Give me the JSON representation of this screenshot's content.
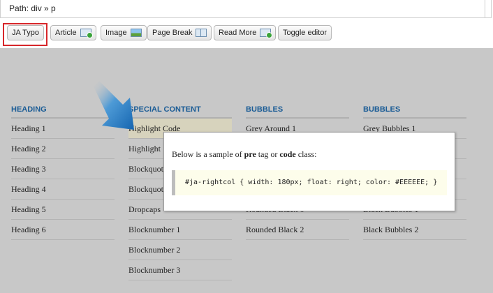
{
  "pathbar": {
    "text": "Path: div » p"
  },
  "toolbar": {
    "buttons": [
      {
        "label": "JA Typo"
      },
      {
        "label": "Article",
        "icon": "document-add-icon"
      },
      {
        "label": "Image",
        "icon": "image-icon"
      },
      {
        "label": "Page Break",
        "icon": "page-break-icon"
      },
      {
        "label": "Read More",
        "icon": "read-more-icon"
      },
      {
        "label": "Toggle editor"
      }
    ]
  },
  "columns": [
    {
      "heading": "HEADING",
      "items": [
        "Heading 1",
        "Heading 2",
        "Heading 3",
        "Heading 4",
        "Heading 5",
        "Heading 6"
      ]
    },
    {
      "heading": "SPECIAL CONTENT",
      "items": [
        "Highlight Code",
        "Highlight",
        "Blockquote",
        "Blockquote",
        "Dropcaps",
        "Blocknumber 1",
        "Blocknumber 2",
        "Blocknumber 3"
      ]
    },
    {
      "heading": "BUBBLES",
      "items": [
        "Grey Around 1",
        "",
        "",
        "",
        "Rounded Black 1",
        "Rounded Black 2"
      ]
    },
    {
      "heading": "BUBBLES",
      "items": [
        "Grey Bubbles 1",
        "",
        "",
        "",
        "Black Bubbles 1",
        "Black Bubbles 2"
      ]
    }
  ],
  "popup": {
    "desc_before": "Below is a sample of ",
    "desc_pre": "pre",
    "desc_mid": " tag or ",
    "desc_code": "code",
    "desc_after": " class:",
    "code": "#ja-rightcol { width: 180px; float: right; color: #EEEEEE; }"
  },
  "colors": {
    "heading": "#1c5d96",
    "highlight_border": "#d7262a",
    "arrow": "#1f78c4"
  }
}
